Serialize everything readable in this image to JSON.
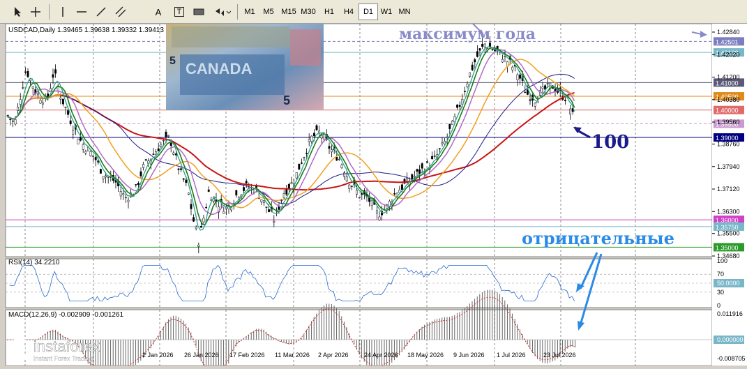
{
  "toolbar": {
    "timeframes": [
      {
        "label": "M1",
        "selected": false
      },
      {
        "label": "M5",
        "selected": false
      },
      {
        "label": "M15",
        "selected": false
      },
      {
        "label": "M30",
        "selected": false
      },
      {
        "label": "H1",
        "selected": false
      },
      {
        "label": "H4",
        "selected": false
      },
      {
        "label": "D1",
        "selected": true
      },
      {
        "label": "W1",
        "selected": false
      },
      {
        "label": "MN",
        "selected": false
      }
    ],
    "tools": [
      "cursor-icon",
      "crosshair-icon",
      "vertical-line-icon",
      "horizontal-line-icon",
      "trendline-icon",
      "channel-icon",
      "text-icon",
      "text-label-icon",
      "rectangle-icon",
      "shapes-icon"
    ],
    "text_tool_label": "A",
    "label_tool_label": "T"
  },
  "main_chart": {
    "symbol_header": "USDCAD,Daily  1.39465 1.39638 1.39332 1.39413",
    "price_ticks": [
      "1.42840",
      "1.42020",
      "1.41200",
      "1.40380",
      "1.39560",
      "1.38760",
      "1.37940",
      "1.37120",
      "1.36300",
      "1.35500",
      "1.34680"
    ],
    "level_labels": [
      {
        "value": "1.42501",
        "color": "#7b7fbf",
        "text_color": "#ffffff"
      },
      {
        "value": "1.42100",
        "color": "#78b6c8",
        "text_color": "#ffffff"
      },
      {
        "value": "1.41000",
        "color": "#5a5a78",
        "text_color": "#ffffff"
      },
      {
        "value": "1.40500",
        "color": "#e08a1a",
        "text_color": "#ffffff"
      },
      {
        "value": "1.40000",
        "color": "#e06a6a",
        "text_color": "#ffffff"
      },
      {
        "value": "1.39500",
        "color": "#c89ad0",
        "text_color": "#ffffff"
      },
      {
        "value": "1.39000",
        "color": "#000080",
        "text_color": "#ffffff"
      },
      {
        "value": "1.36000",
        "color": "#d040c8",
        "text_color": "#ffffff"
      },
      {
        "value": "1.35750",
        "color": "#78b6c8",
        "text_color": "#ffffff"
      },
      {
        "value": "1.35000",
        "color": "#2a9a2a",
        "text_color": "#ffffff"
      }
    ],
    "annotations": {
      "year_high": "максимум года",
      "ma_100": "100",
      "negative": "отрицательные"
    },
    "date_labels": [
      "2 Jan 2026",
      "26 Jan 2026",
      "17 Feb 2026",
      "11 Mar 2026",
      "2 Apr 2026",
      "24 Apr 2026",
      "18 May 2026",
      "9 Jun 2026",
      "1 Jul 2026",
      "23 Jul 2026"
    ],
    "colors": {
      "ema_fast": "#2f9e8f",
      "ema_mid": "#1a7a1a",
      "ma_slow": "#b06ac8",
      "ma_orange": "#f0a020",
      "ma_100": "#1a1a8a",
      "ma_200": "#c81414"
    },
    "image_alt": "Canadian banknotes"
  },
  "rsi": {
    "header": "RSI(14) 34.2210",
    "ticks": [
      "100",
      "70",
      "50.0000",
      "30",
      "0"
    ]
  },
  "macd": {
    "header": "MACD(12,26,9) -0.002909 -0.001261",
    "ticks": [
      "0.011916",
      "0.000000",
      "-0.008705"
    ]
  },
  "branding": {
    "name": "instaforex",
    "tagline": "Instant Forex Trading"
  }
}
